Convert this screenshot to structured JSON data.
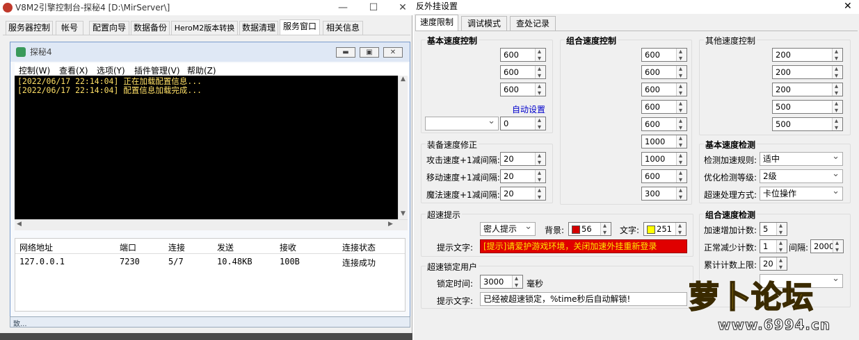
{
  "left_window": {
    "title": "V8M2引擎控制台-探秘4 [D:\\MirServer\\]",
    "tabs": [
      "服务器控制",
      "帐号",
      "配置向导",
      "数据备份",
      "HeroM2版本转换",
      "数据清理",
      "服务窗口",
      "相关信息"
    ],
    "inner": {
      "title": "探秘4",
      "menu": [
        "控制(W)",
        "查看(X)",
        "选项(Y)",
        "插件管理(V)",
        "帮助(Z)"
      ],
      "console_lines": [
        "[2022/06/17 22:14:04] 正在加载配置信息...",
        "[2022/06/17 22:14:04] 配置信息加载完成..."
      ],
      "grid_headers": [
        "网络地址",
        "端口",
        "连接",
        "发送",
        "接收",
        "连接状态"
      ],
      "grid_row": [
        "127.0.0.1",
        "7230",
        "5/7",
        "10.48KB",
        "100B",
        "连接成功"
      ],
      "taskbar_label": "致..."
    }
  },
  "right_window": {
    "title": "反外挂设置",
    "tabs": [
      "速度限制",
      "调试模式",
      "查处记录"
    ],
    "basic": {
      "title": "基本速度控制",
      "values": [
        "600",
        "600",
        "600"
      ],
      "auto_link": "自动设置",
      "combo_value": "",
      "spin_value": "0"
    },
    "equip": {
      "title": "装备速度修正",
      "rows": [
        {
          "label": "攻击速度+1减间隔:",
          "value": "20"
        },
        {
          "label": "移动速度+1减间隔:",
          "value": "20"
        },
        {
          "label": "魔法速度+1减间隔:",
          "value": "20"
        }
      ]
    },
    "combo": {
      "title": "组合速度控制",
      "values": [
        "600",
        "600",
        "600",
        "600",
        "600",
        "1000",
        "1000",
        "600",
        "300"
      ]
    },
    "other": {
      "title": "其他速度控制",
      "values": [
        "200",
        "200",
        "200",
        "500",
        "500"
      ]
    },
    "basic_detect": {
      "title": "基本速度检测",
      "rows": [
        {
          "label": "检测加速规则:",
          "value": "适中"
        },
        {
          "label": "优化检测等级:",
          "value": "2级"
        },
        {
          "label": "超速处理方式:",
          "value": "卡位操作"
        }
      ]
    },
    "hint": {
      "title": "超速提示",
      "mode": "密人提示",
      "bg_label": "背景:",
      "bg_value": "56",
      "fg_label": "文字:",
      "fg_value": "251",
      "text_label": "提示文字:",
      "text_value": "[提示]请爱护游戏环境，关闭加速外挂重新登录"
    },
    "combo_detect": {
      "title": "组合速度检测",
      "inc_label": "加速增加计数:",
      "inc_value": "5",
      "dec_label": "正常减少计数:",
      "dec_value": "1",
      "interval_label": "间隔:",
      "interval_value": "2000",
      "limit_label": "累计计数上限:",
      "limit_value": "20"
    },
    "lock": {
      "title": "超速锁定用户",
      "time_label": "锁定时间:",
      "time_value": "3000",
      "time_unit": "毫秒",
      "text_label": "提示文字:",
      "text_value": "已经被超速锁定，%time秒后自动解锁!"
    }
  },
  "watermark": {
    "text": "萝卜论坛",
    "url": "www.6994.cn"
  },
  "colors": {
    "alert_red": "#e00000",
    "alert_text": "#ffe600",
    "swatch_bg": "#d40000",
    "swatch_fg": "#ffff00",
    "link_blue": "#0000cc"
  }
}
